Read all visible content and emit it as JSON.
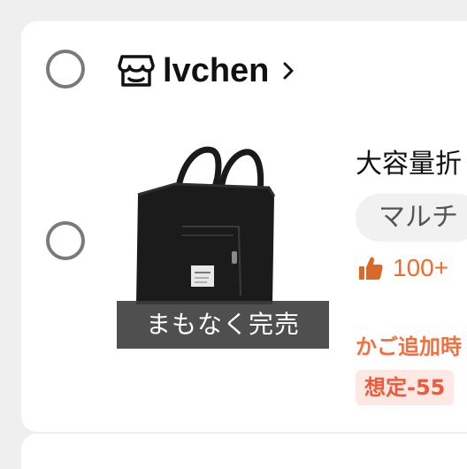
{
  "shop": {
    "name": "lvchen",
    "icon": "store-icon",
    "chevron": "chevron-right-icon"
  },
  "item": {
    "image_alt": "black foldable travel bag",
    "stock_overlay": "まもなく完売",
    "title": "大容量折",
    "variant": "マルチ",
    "likes": "100+",
    "likes_icon": "thumbs-up-icon",
    "cart_text": "かご追加時",
    "price_badge": "想定-55"
  },
  "colors": {
    "accent_orange": "#f36b2a",
    "badge_bg": "#fde8e4",
    "badge_text": "#ee5a3a",
    "radio_border": "#7a7a7a"
  }
}
